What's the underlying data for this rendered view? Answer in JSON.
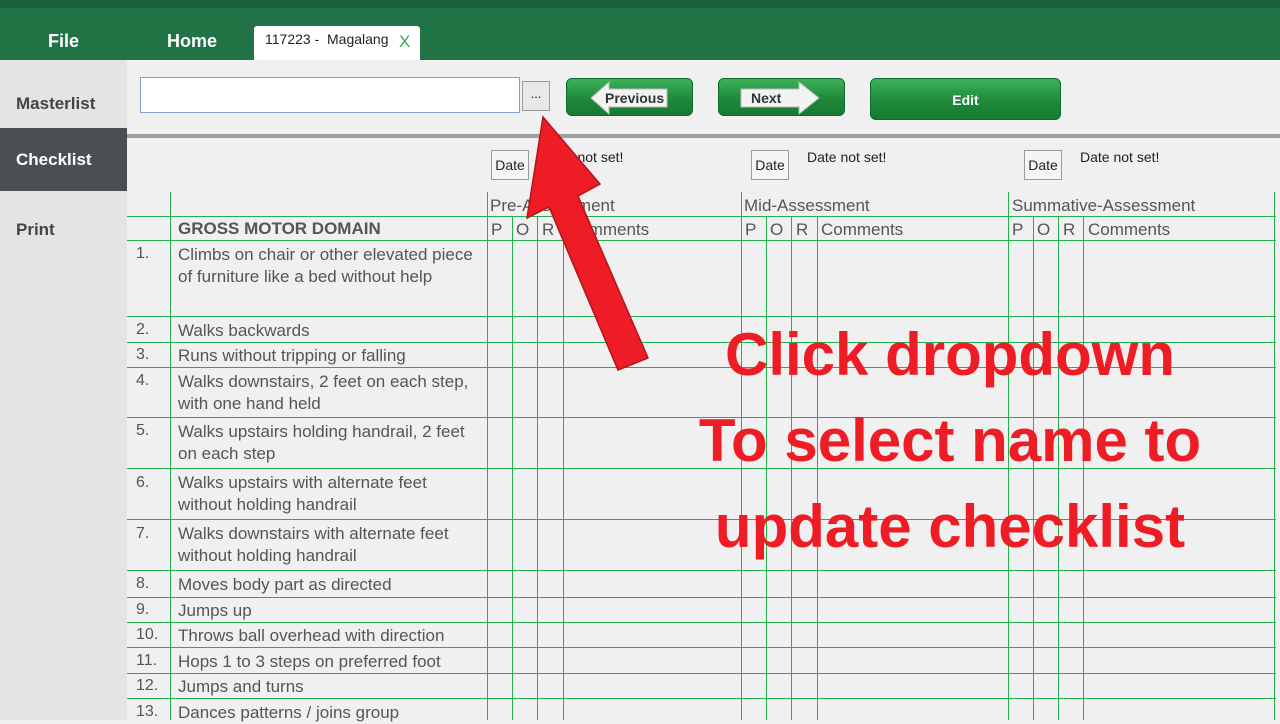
{
  "menu": {
    "file": "File",
    "home": "Home"
  },
  "tab": {
    "label": "117223 -  Magalang",
    "close": "X"
  },
  "sidebar": {
    "items": [
      {
        "label": "Masterlist"
      },
      {
        "label": "Checklist",
        "active": true
      },
      {
        "label": "Print"
      }
    ]
  },
  "toolbar": {
    "search": {
      "value": "",
      "placeholder": ""
    },
    "dots": "...",
    "previous": "Previous",
    "next": "Next",
    "edit": "Edit"
  },
  "dates": {
    "pre": {
      "button": "Date",
      "text": "Date not set!"
    },
    "mid": {
      "button": "Date",
      "text": "Date not set!"
    },
    "summative": {
      "button": "Date",
      "text": "Date not set!"
    }
  },
  "table": {
    "groups": {
      "pre": "Pre-Assessment",
      "mid": "Mid-Assessment",
      "summative": "Summative-Assessment"
    },
    "domain": "GROSS MOTOR DOMAIN",
    "cols": {
      "p": "P",
      "o": "O",
      "r": "R",
      "comments": "Comments"
    },
    "rows": [
      {
        "num": "1.",
        "text": "Climbs on chair or other elevated piece of furniture like a bed without help"
      },
      {
        "num": "2.",
        "text": "Walks backwards"
      },
      {
        "num": "3.",
        "text": "Runs without tripping or falling"
      },
      {
        "num": "4.",
        "text": "Walks downstairs, 2 feet on each step, with one hand held"
      },
      {
        "num": "5.",
        "text": "Walks upstairs holding handrail, 2 feet on each step"
      },
      {
        "num": "6.",
        "text": "Walks upstairs with alternate feet without holding handrail"
      },
      {
        "num": "7.",
        "text": "Walks downstairs with alternate feet without holding handrail"
      },
      {
        "num": "8.",
        "text": "Moves body part as directed"
      },
      {
        "num": "9.",
        "text": "Jumps up"
      },
      {
        "num": "10.",
        "text": "Throws ball overhead with direction"
      },
      {
        "num": "11.",
        "text": "Hops 1 to 3 steps on preferred foot"
      },
      {
        "num": "12.",
        "text": "Jumps and turns"
      },
      {
        "num": "13.",
        "text": "Dances patterns / joins group"
      }
    ]
  },
  "annotation": {
    "line1": "Click dropdown",
    "line2": "To select name to",
    "line3": "update checklist",
    "color": "#ee1c25"
  }
}
